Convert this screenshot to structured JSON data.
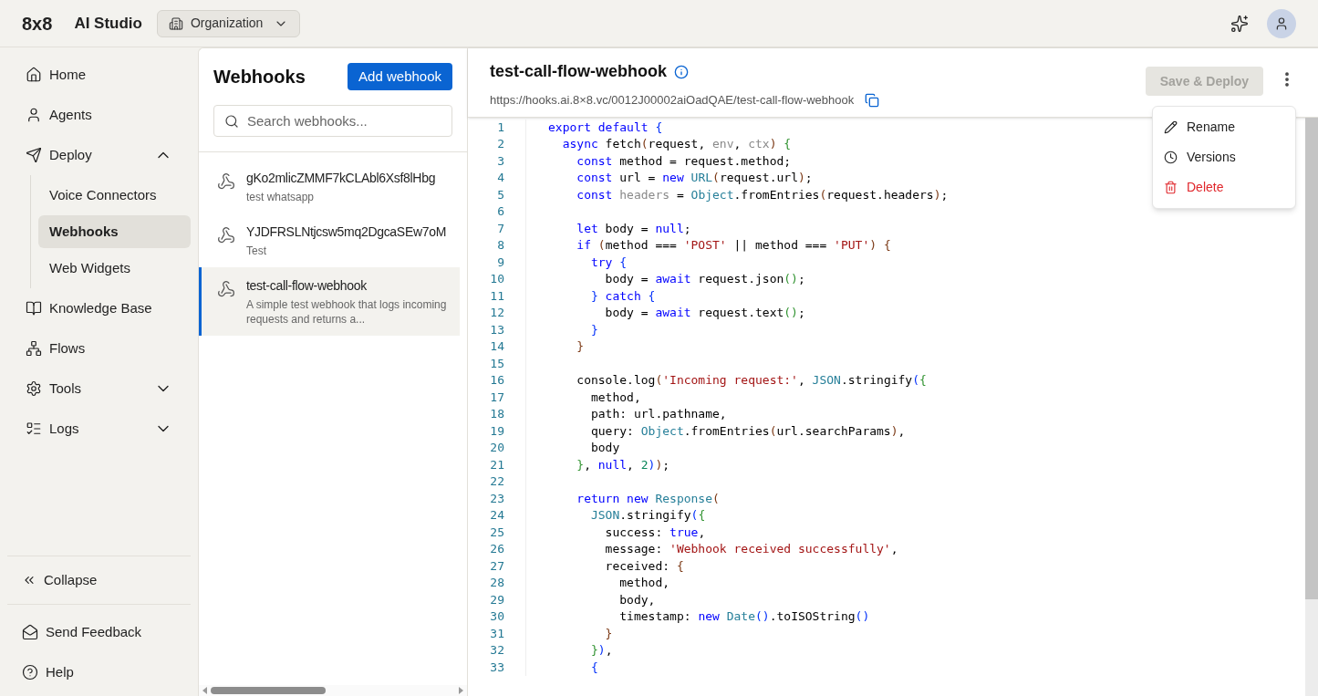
{
  "header": {
    "logo": "8x8",
    "product": "AI Studio",
    "org_button": "Organization"
  },
  "nav": [
    {
      "label": "Home",
      "selected": false
    },
    {
      "label": "Agents",
      "selected": false
    },
    {
      "label": "Deploy",
      "expanded": true,
      "children": [
        {
          "label": "Voice Connectors",
          "selected": false
        },
        {
          "label": "Webhooks",
          "selected": true
        },
        {
          "label": "Web Widgets",
          "selected": false
        }
      ]
    },
    {
      "label": "Knowledge Base",
      "selected": false
    },
    {
      "label": "Flows",
      "selected": false
    },
    {
      "label": "Tools",
      "expanded": false
    },
    {
      "label": "Logs",
      "expanded": false
    }
  ],
  "sidebar_footer": {
    "collapse": "Collapse",
    "feedback": "Send Feedback",
    "help": "Help"
  },
  "list_panel": {
    "title": "Webhooks",
    "add_button": "Add webhook",
    "search": {
      "placeholder": "Search webhooks..."
    },
    "items": [
      {
        "name": "gKo2mlicZMMF7kCLAbl6Xsf8lHbg",
        "description": "test whatsapp",
        "selected": false
      },
      {
        "name": "YJDFRSLNtjcsw5mq2DgcaSEw7oM",
        "description": "Test",
        "selected": false
      },
      {
        "name": "test-call-flow-webhook",
        "description": "A simple test webhook that logs incoming requests and returns a...",
        "selected": true
      }
    ]
  },
  "editor": {
    "title": "test-call-flow-webhook",
    "url": "https://hooks.ai.8×8.vc/0012J00002aiOadQAE/test-call-flow-webhook",
    "save_button": {
      "label": "Save & Deploy",
      "disabled": true
    },
    "menu": [
      {
        "label": "Rename",
        "kind": "normal"
      },
      {
        "label": "Versions",
        "kind": "normal"
      },
      {
        "label": "Delete",
        "kind": "danger"
      }
    ],
    "lines": [
      {
        "number": "1",
        "tokens": [
          {
            "text": "export default ",
            "kind": "kw"
          },
          {
            "text": "{",
            "kind": "bl"
          }
        ]
      },
      {
        "number": "2",
        "tokens": [
          {
            "text": "  async",
            "kind": "kw"
          },
          {
            "text": " fetch",
            "kind": "plain"
          },
          {
            "text": "(",
            "kind": "br"
          },
          {
            "text": "request, ",
            "kind": "plain"
          },
          {
            "text": "env",
            "kind": "dim"
          },
          {
            "text": ", ",
            "kind": "plain"
          },
          {
            "text": "ctx",
            "kind": "dim"
          },
          {
            "text": ")",
            "kind": "br"
          },
          {
            "text": " {",
            "kind": "gr"
          }
        ]
      },
      {
        "number": "3",
        "tokens": [
          {
            "text": "    const",
            "kind": "kw"
          },
          {
            "text": " method = request.method;",
            "kind": "plain"
          }
        ]
      },
      {
        "number": "4",
        "tokens": [
          {
            "text": "    const",
            "kind": "kw"
          },
          {
            "text": " url = ",
            "kind": "plain"
          },
          {
            "text": "new",
            "kind": "kw"
          },
          {
            "text": " URL",
            "kind": "type"
          },
          {
            "text": "(",
            "kind": "br"
          },
          {
            "text": "request.url",
            "kind": "plain"
          },
          {
            "text": ")",
            "kind": "br"
          },
          {
            "text": ";",
            "kind": "plain"
          }
        ]
      },
      {
        "number": "5",
        "tokens": [
          {
            "text": "    const",
            "kind": "kw"
          },
          {
            "text": " headers",
            "kind": "dim"
          },
          {
            "text": " = ",
            "kind": "plain"
          },
          {
            "text": "Object",
            "kind": "type"
          },
          {
            "text": ".fromEntries",
            "kind": "plain"
          },
          {
            "text": "(",
            "kind": "br"
          },
          {
            "text": "request.headers",
            "kind": "plain"
          },
          {
            "text": ")",
            "kind": "br"
          },
          {
            "text": ";",
            "kind": "plain"
          }
        ]
      },
      {
        "number": "6"
      },
      {
        "number": "7",
        "tokens": [
          {
            "text": "    let",
            "kind": "kw"
          },
          {
            "text": " body = ",
            "kind": "plain"
          },
          {
            "text": "null",
            "kind": "kw"
          },
          {
            "text": ";",
            "kind": "plain"
          }
        ]
      },
      {
        "number": "8",
        "tokens": [
          {
            "text": "    if",
            "kind": "kw"
          },
          {
            "text": " (",
            "kind": "br"
          },
          {
            "text": "method === ",
            "kind": "plain"
          },
          {
            "text": "'POST'",
            "kind": "str"
          },
          {
            "text": " || method === ",
            "kind": "plain"
          },
          {
            "text": "'PUT'",
            "kind": "str"
          },
          {
            "text": ")",
            "kind": "br"
          },
          {
            "text": " {",
            "kind": "br"
          }
        ]
      },
      {
        "number": "9",
        "tokens": [
          {
            "text": "      try",
            "kind": "kw"
          },
          {
            "text": " {",
            "kind": "bl"
          }
        ]
      },
      {
        "number": "10",
        "tokens": [
          {
            "text": "        body = ",
            "kind": "plain"
          },
          {
            "text": "await",
            "kind": "kw"
          },
          {
            "text": " request.json",
            "kind": "plain"
          },
          {
            "text": "()",
            "kind": "gr"
          },
          {
            "text": ";",
            "kind": "plain"
          }
        ]
      },
      {
        "number": "11",
        "tokens": [
          {
            "text": "      }",
            "kind": "bl"
          },
          {
            "text": " catch",
            "kind": "kw"
          },
          {
            "text": " {",
            "kind": "bl"
          }
        ]
      },
      {
        "number": "12",
        "tokens": [
          {
            "text": "        body = ",
            "kind": "plain"
          },
          {
            "text": "await",
            "kind": "kw"
          },
          {
            "text": " request.text",
            "kind": "plain"
          },
          {
            "text": "()",
            "kind": "gr"
          },
          {
            "text": ";",
            "kind": "plain"
          }
        ]
      },
      {
        "number": "13",
        "tokens": [
          {
            "text": "      }",
            "kind": "bl"
          }
        ]
      },
      {
        "number": "14",
        "tokens": [
          {
            "text": "    }",
            "kind": "br"
          }
        ]
      },
      {
        "number": "15"
      },
      {
        "number": "16",
        "tokens": [
          {
            "text": "    console.log",
            "kind": "plain"
          },
          {
            "text": "(",
            "kind": "br"
          },
          {
            "text": "'Incoming request:'",
            "kind": "str"
          },
          {
            "text": ", ",
            "kind": "plain"
          },
          {
            "text": "JSON",
            "kind": "type"
          },
          {
            "text": ".stringify",
            "kind": "plain"
          },
          {
            "text": "(",
            "kind": "bl"
          },
          {
            "text": "{",
            "kind": "gr"
          }
        ]
      },
      {
        "number": "17",
        "tokens": [
          {
            "text": "      method,",
            "kind": "plain"
          }
        ]
      },
      {
        "number": "18",
        "tokens": [
          {
            "text": "      path: url.pathname,",
            "kind": "plain"
          }
        ]
      },
      {
        "number": "19",
        "tokens": [
          {
            "text": "      query: ",
            "kind": "plain"
          },
          {
            "text": "Object",
            "kind": "type"
          },
          {
            "text": ".fromEntries",
            "kind": "plain"
          },
          {
            "text": "(",
            "kind": "br"
          },
          {
            "text": "url.searchParams",
            "kind": "plain"
          },
          {
            "text": ")",
            "kind": "br"
          },
          {
            "text": ",",
            "kind": "plain"
          }
        ]
      },
      {
        "number": "20",
        "tokens": [
          {
            "text": "      body",
            "kind": "plain"
          }
        ]
      },
      {
        "number": "21",
        "tokens": [
          {
            "text": "    }",
            "kind": "gr"
          },
          {
            "text": ", ",
            "kind": "plain"
          },
          {
            "text": "null",
            "kind": "kw"
          },
          {
            "text": ", ",
            "kind": "plain"
          },
          {
            "text": "2",
            "kind": "num"
          },
          {
            "text": ")",
            "kind": "bl"
          },
          {
            "text": ")",
            "kind": "br"
          },
          {
            "text": ";",
            "kind": "plain"
          }
        ]
      },
      {
        "number": "22"
      },
      {
        "number": "23",
        "tokens": [
          {
            "text": "    return new ",
            "kind": "kw"
          },
          {
            "text": "Response",
            "kind": "type"
          },
          {
            "text": "(",
            "kind": "br"
          }
        ]
      },
      {
        "number": "24",
        "tokens": [
          {
            "text": "      JSON",
            "kind": "type"
          },
          {
            "text": ".stringify",
            "kind": "plain"
          },
          {
            "text": "(",
            "kind": "bl"
          },
          {
            "text": "{",
            "kind": "gr"
          }
        ]
      },
      {
        "number": "25",
        "tokens": [
          {
            "text": "        success: ",
            "kind": "plain"
          },
          {
            "text": "true",
            "kind": "kw"
          },
          {
            "text": ",",
            "kind": "plain"
          }
        ]
      },
      {
        "number": "26",
        "tokens": [
          {
            "text": "        message: ",
            "kind": "plain"
          },
          {
            "text": "'Webhook received successfully'",
            "kind": "str"
          },
          {
            "text": ",",
            "kind": "plain"
          }
        ]
      },
      {
        "number": "27",
        "tokens": [
          {
            "text": "        received: ",
            "kind": "plain"
          },
          {
            "text": "{",
            "kind": "br"
          }
        ]
      },
      {
        "number": "28",
        "tokens": [
          {
            "text": "          method,",
            "kind": "plain"
          }
        ]
      },
      {
        "number": "29",
        "tokens": [
          {
            "text": "          body,",
            "kind": "plain"
          }
        ]
      },
      {
        "number": "30",
        "tokens": [
          {
            "text": "          timestamp: ",
            "kind": "plain"
          },
          {
            "text": "new",
            "kind": "kw"
          },
          {
            "text": " Date",
            "kind": "type"
          },
          {
            "text": "()",
            "kind": "bl"
          },
          {
            "text": ".toISOString",
            "kind": "plain"
          },
          {
            "text": "()",
            "kind": "bl"
          }
        ]
      },
      {
        "number": "31",
        "tokens": [
          {
            "text": "        }",
            "kind": "br"
          }
        ]
      },
      {
        "number": "32",
        "tokens": [
          {
            "text": "      }",
            "kind": "gr"
          },
          {
            "text": ")",
            "kind": "bl"
          },
          {
            "text": ",",
            "kind": "plain"
          }
        ]
      },
      {
        "number": "33",
        "tokens": [
          {
            "text": "      {",
            "kind": "bl"
          }
        ]
      }
    ]
  }
}
